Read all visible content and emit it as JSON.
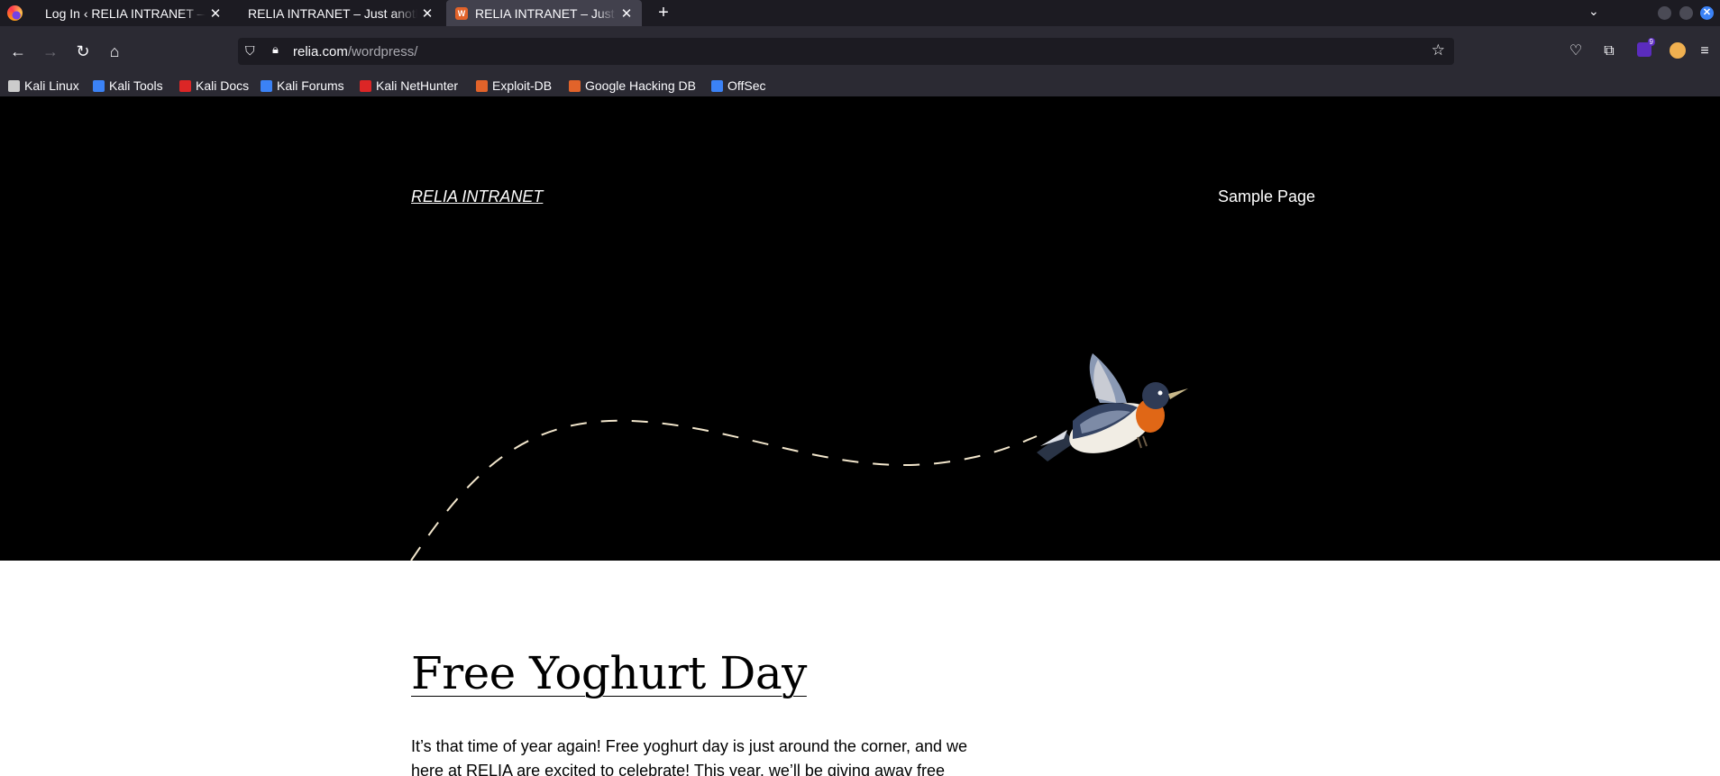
{
  "browser": {
    "tabs": [
      {
        "title": "Log In ‹ RELIA INTRANET — WordPress",
        "active": false
      },
      {
        "title": "RELIA INTRANET – Just another WordPress site",
        "active": false
      },
      {
        "title": "RELIA INTRANET – Just another WordPress site",
        "active": true
      }
    ],
    "url_host": "relia.com",
    "url_path": "/wordpress/",
    "extension_badge": "9",
    "bookmarks": [
      {
        "label": "Kali Linux",
        "color": "#cccccc"
      },
      {
        "label": "Kali Tools",
        "color": "#3b82f6"
      },
      {
        "label": "Kali Docs",
        "color": "#dc2626"
      },
      {
        "label": "Kali Forums",
        "color": "#3b82f6"
      },
      {
        "label": "Kali NetHunter",
        "color": "#dc2626"
      },
      {
        "label": "Exploit-DB",
        "color": "#e2632a"
      },
      {
        "label": "Google Hacking DB",
        "color": "#e2632a"
      },
      {
        "label": "OffSec",
        "color": "#3b82f6"
      }
    ]
  },
  "site": {
    "title": "RELIA INTRANET",
    "nav_link": "Sample Page"
  },
  "post": {
    "title": "Free Yoghurt Day",
    "body": "It’s that time of year again! Free yoghurt day is just around the corner, and we here at RELIA are excited to celebrate! This year, we’ll be giving away free yoghurt"
  }
}
